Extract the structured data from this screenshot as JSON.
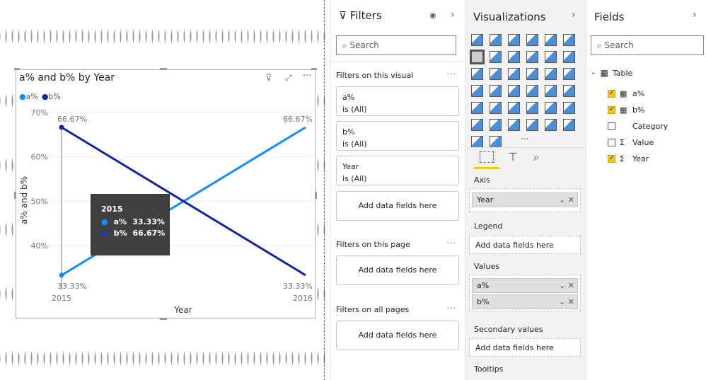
{
  "visual": {
    "title": "a% and b% by Year",
    "legend": [
      {
        "label": "a%",
        "color": "#118dff"
      },
      {
        "label": "b%",
        "color": "#12239e"
      }
    ],
    "icons": [
      "filter-icon",
      "focus-mode-icon",
      "more-options-icon"
    ]
  },
  "chart_data": {
    "type": "line",
    "title": "a% and b% by Year",
    "xlabel": "Year",
    "ylabel": "a% and b%",
    "categories": [
      "2015",
      "2016"
    ],
    "series": [
      {
        "name": "a%",
        "values": [
          33.33,
          66.67
        ],
        "color": "#118dff"
      },
      {
        "name": "b%",
        "values": [
          66.67,
          33.33
        ],
        "color": "#12239e"
      }
    ],
    "data_labels": [
      "33.33%",
      "66.67%",
      "66.67%",
      "33.33%"
    ],
    "yticks": [
      "40%",
      "50%",
      "60%",
      "70%"
    ],
    "ylim": [
      30,
      70
    ],
    "grid": true,
    "legend": "top-left"
  },
  "tooltip": {
    "title": "2015",
    "rows": [
      {
        "label": "a%",
        "value": "33.33%",
        "color": "#118dff"
      },
      {
        "label": "b%",
        "value": "66.67%",
        "color": "#2b39a8"
      }
    ]
  },
  "filters": {
    "title": "Filters",
    "search": "Search",
    "on_visual": "Filters on this visual",
    "cards": [
      {
        "name": "a%",
        "state": "is (All)"
      },
      {
        "name": "b%",
        "state": "is (All)"
      },
      {
        "name": "Year",
        "state": "is (All)"
      }
    ],
    "add": "Add data fields here",
    "on_page": "Filters on this page",
    "on_all": "Filters on all pages"
  },
  "viz": {
    "title": "Visualizations",
    "axis": "Axis",
    "axis_field": "Year",
    "legend": "Legend",
    "values": "Values",
    "values_fields": [
      "a%",
      "b%"
    ],
    "secondary": "Secondary values",
    "tooltips": "Tooltips",
    "add": "Add data fields here",
    "more": "...",
    "accent": "#f2c811"
  },
  "fields": {
    "title": "Fields",
    "search": "Search",
    "table": "Table",
    "items": [
      {
        "name": "a%",
        "checked": true,
        "icon": "calculator-icon"
      },
      {
        "name": "b%",
        "checked": true,
        "icon": "calculator-icon"
      },
      {
        "name": "Category",
        "checked": false,
        "icon": ""
      },
      {
        "name": "Value",
        "checked": false,
        "icon": "sigma-icon"
      },
      {
        "name": "Year",
        "checked": true,
        "icon": "sigma-icon"
      }
    ]
  }
}
